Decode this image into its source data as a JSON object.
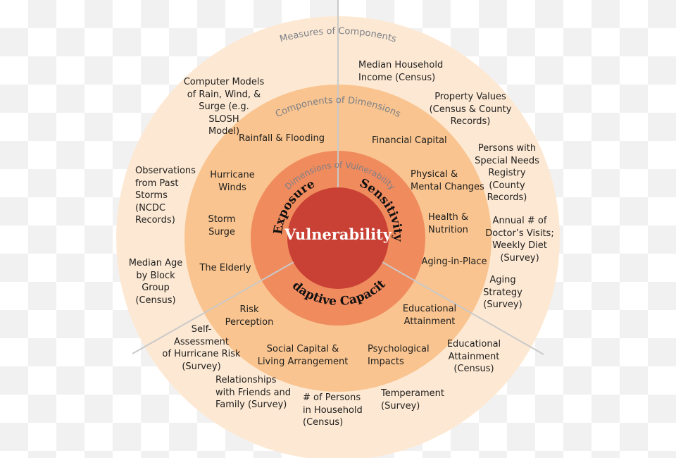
{
  "colors": {
    "outer_ring": "#fde9d3",
    "middle_ring": "#f9c48f",
    "inner_ring": "#f08b5e",
    "core": "#c94134",
    "spokes": "#c9c9c9",
    "ring_titles": "#7b7f87"
  },
  "core": {
    "label": "Vulnerability"
  },
  "ring_titles": {
    "measures": "Measures of Components",
    "components": "Components of Dimensions",
    "dimensions": "Dimensions of Vulnerability"
  },
  "dimensions": {
    "exposure": "Exposure",
    "sensitivity": "Sensitivity",
    "adaptive": "Adaptive Capacity"
  },
  "components": [
    "Rainfall & Flooding",
    "Financial  Capital",
    "Hurricane\nWinds",
    "Physical &\nMental Changes",
    "Storm\nSurge",
    "Health &\nNutrition",
    "The Elderly",
    "Aging-in-Place",
    "Risk\nPerception",
    "Educational\nAttainment",
    "Social Capital &\nLiving Arrangement",
    "Psychological\nImpacts"
  ],
  "measures": [
    "Median Household\nIncome (Census)",
    "Property Values\n(Census & County\nRecords)",
    "Persons with\nSpecial Needs\nRegistry\n(County\nRecords)",
    "Annual # of\nDoctor’s Visits;\nWeekly Diet\n(Survey)",
    "Aging\nStrategy\n(Survey)",
    "Educational\nAttainment\n(Census)",
    "Temperament\n(Survey)",
    "# of Persons\nin Household\n(Census)",
    "Relationships\nwith Friends and\nFamily (Survey)",
    "Self-\nAssessment\nof Hurricane Risk\n(Survey)",
    "Median Age\nby Block\nGroup\n(Census)",
    "Observations\nfrom Past\nStorms\n(NCDC\nRecords)",
    "Computer Models\nof Rain, Wind, &\nSurge (e.g.\nSLOSH\nModel)"
  ]
}
